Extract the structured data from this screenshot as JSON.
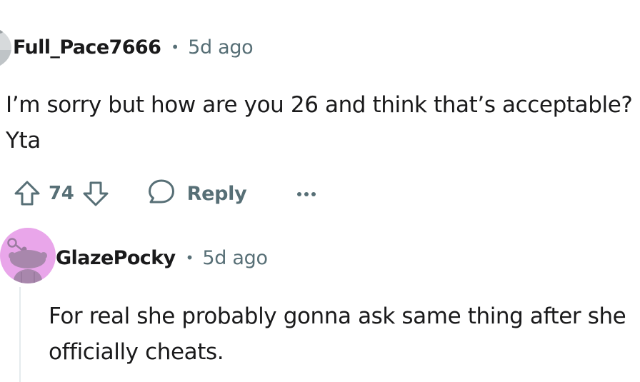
{
  "comments": [
    {
      "username": "Full_Pace7666",
      "separator": "•",
      "timestamp": "5d ago",
      "body_lines": [
        "I’m sorry but how are you 26 and think that’s acceptable?",
        "Yta"
      ],
      "upvote_icon": "upvote-arrow-icon",
      "downvote_icon": "downvote-arrow-icon",
      "vote_count": "74",
      "reply_icon": "speech-bubble-icon",
      "reply_label": "Reply",
      "more_icon": "ellipsis-icon"
    },
    {
      "username": "GlazePocky",
      "separator": "•",
      "timestamp": "5d ago",
      "avatar_color": "#e9a6ea",
      "body_lines": [
        "For real she probably gonna ask same thing after she",
        "officially cheats."
      ]
    }
  ],
  "colors": {
    "text_primary": "#1a1a1b",
    "text_secondary": "#576f76",
    "thread_line": "#e5ebee"
  }
}
